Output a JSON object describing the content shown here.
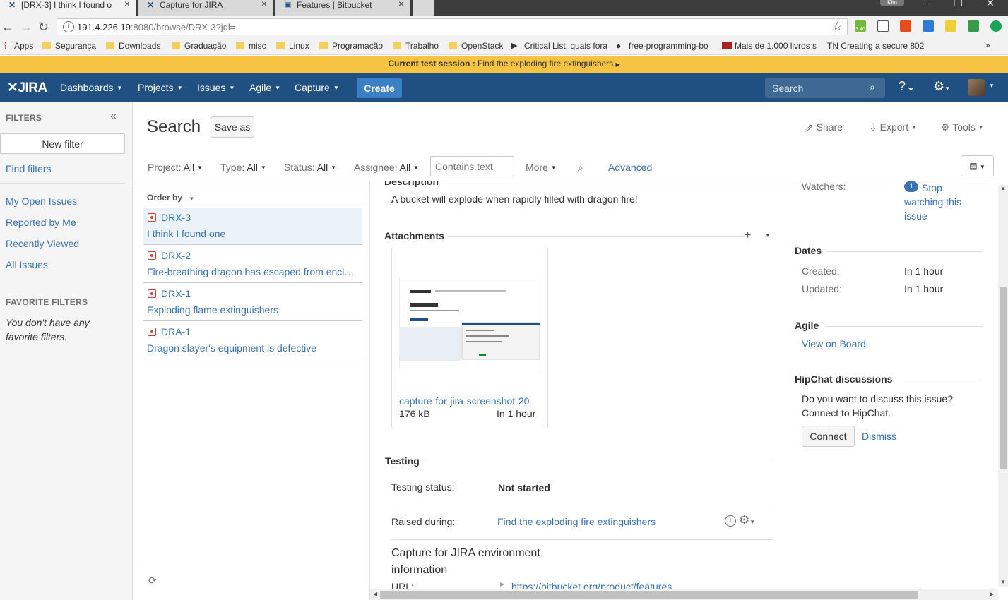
{
  "browser": {
    "tabs": [
      {
        "title": "[DRX-3] I think I found o",
        "active": true
      },
      {
        "title": "Capture for JIRA",
        "active": false
      },
      {
        "title": "Features | Bitbucket",
        "active": false
      }
    ],
    "profile": "Kim",
    "url_main": "191.4.226.19",
    "url_rest": ":8080/browse/DRX-3?jql=",
    "bookmarks": [
      "Apps",
      "Segurança",
      "Downloads",
      "Graduação",
      "misc",
      "Linux",
      "Programação",
      "Trabalho",
      "OpenStack",
      "Critical List: quais fora",
      "free-programming-bo",
      "Mais de 1.000 livros s",
      "TN Creating a secure 802"
    ],
    "ext_badge": "3.40"
  },
  "session_bar": {
    "label": "Current test session :",
    "value": "Find the exploding fire extinguishers"
  },
  "header": {
    "logo": "JIRA",
    "nav": [
      "Dashboards",
      "Projects",
      "Issues",
      "Agile",
      "Capture"
    ],
    "create": "Create",
    "search_placeholder": "Search"
  },
  "sidebar": {
    "filters_title": "FILTERS",
    "new_filter": "New filter",
    "find_filters": "Find filters",
    "links": [
      "My Open Issues",
      "Reported by Me",
      "Recently Viewed",
      "All Issues"
    ],
    "favorite_title": "FAVORITE FILTERS",
    "favorite_empty": "You don't have any favorite filters."
  },
  "main": {
    "title": "Search",
    "save_as": "Save as",
    "tools": {
      "share": "Share",
      "export": "Export",
      "tools": "Tools"
    },
    "criteria": [
      {
        "label": "Project:",
        "value": "All"
      },
      {
        "label": "Type:",
        "value": "All"
      },
      {
        "label": "Status:",
        "value": "All"
      },
      {
        "label": "Assignee:",
        "value": "All"
      }
    ],
    "contains_placeholder": "Contains text",
    "more": "More",
    "advanced": "Advanced",
    "order_by": "Order by",
    "issues": [
      {
        "key": "DRX-3",
        "summary": "I think I found one",
        "selected": true
      },
      {
        "key": "DRX-2",
        "summary": "Fire-breathing dragon has escaped from encl…",
        "selected": false
      },
      {
        "key": "DRX-1",
        "summary": "Exploding flame extinguishers",
        "selected": false
      },
      {
        "key": "DRA-1",
        "summary": "Dragon slayer's equipment is defective",
        "selected": false
      }
    ]
  },
  "detail": {
    "description_head": "Description",
    "description": "A bucket will explode when rapidly filled with dragon fire!",
    "attachments_head": "Attachments",
    "attachment": {
      "name": "capture-for-jira-screenshot-20",
      "size": "176 kB",
      "date": "In 1 hour"
    },
    "testing_head": "Testing",
    "testing_status_label": "Testing status:",
    "testing_status_value": "Not started",
    "raised_label": "Raised during:",
    "raised_value": "Find the exploding fire extinguishers",
    "env_title": "Capture for JIRA environment information",
    "url_label": "URL:",
    "url_value": "https://bitbucket.org/product/features"
  },
  "right": {
    "watchers_label": "Watchers:",
    "watchers_count": "1",
    "watchers_link": "Stop watching this issue",
    "dates_head": "Dates",
    "created_label": "Created:",
    "created_value": "In 1 hour",
    "updated_label": "Updated:",
    "updated_value": "In 1 hour",
    "agile_head": "Agile",
    "view_on_board": "View on Board",
    "hipchat_head": "HipChat discussions",
    "hipchat_text": "Do you want to discuss this issue? Connect to HipChat.",
    "connect": "Connect",
    "dismiss": "Dismiss"
  }
}
